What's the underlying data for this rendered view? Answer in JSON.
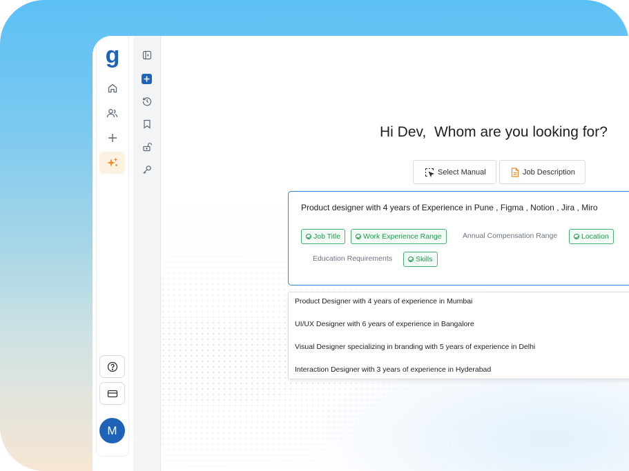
{
  "rail": {
    "logo": "g",
    "avatar_initial": "M"
  },
  "main": {
    "greeting": "Hi Dev,  Whom are you looking for?",
    "modes": [
      {
        "label": "Select Manual"
      },
      {
        "label": "Job Description"
      }
    ],
    "query": "Product designer with 4 years of Experience in Pune , Figma , Notion , Jira , Miro",
    "chips": {
      "job_title": "Job Title",
      "work_experience": "Work Experience Range",
      "annual_comp": "Annual Compensation Range",
      "location": "Location",
      "education": "Education Requirements",
      "skills": "Skills"
    },
    "suggestions": [
      "Product Designer with 4 years of experience in Mumbai",
      "UI/UX Designer with 6 years of experience in Bangalore",
      "Visual Designer specializing in branding with 5 years of experience in Delhi",
      "Interaction Designer with 3 years of experience in Hyderabad"
    ]
  },
  "colors": {
    "brand": "#1e63b8",
    "accent_orange": "#f08a24",
    "chip_green": "#1f9a4d",
    "focus_blue": "#2f86d8"
  },
  "icons": [
    "home-icon",
    "users-icon",
    "plus-icon",
    "sparkle-icon",
    "help-icon",
    "card-icon",
    "sidebar-toggle-icon",
    "new-icon",
    "history-icon",
    "bookmark-icon",
    "unlock-icon",
    "key-icon",
    "select-cursor-icon",
    "document-icon",
    "check-circle-icon"
  ]
}
